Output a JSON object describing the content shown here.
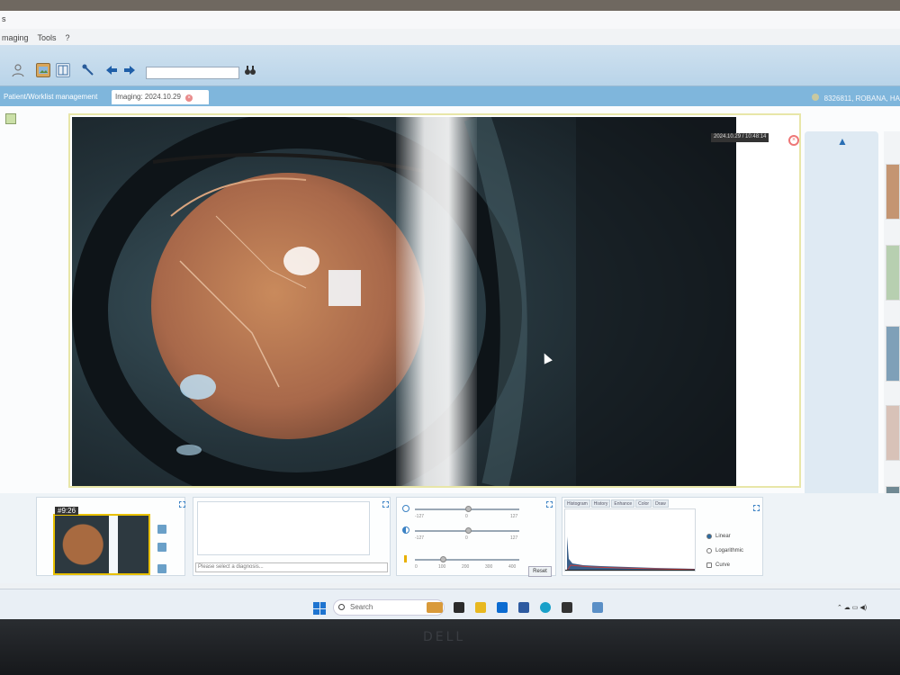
{
  "window": {
    "title_fragment": "s"
  },
  "menu": [
    "maging",
    "Tools",
    "?"
  ],
  "toolbar": {
    "buttons": [
      "users-icon",
      "picture-icon",
      "layout-icon",
      "tool-icon",
      "back-arrow-icon",
      "forward-arrow-icon",
      "binoculars-icon"
    ],
    "search_value": ""
  },
  "tabs": [
    {
      "label": "Patient/Worklist management",
      "active": true
    },
    {
      "label": "Imaging: 2024.10.29",
      "active": false,
      "closable": true
    }
  ],
  "patient_info": "8326811, ROBANA, HA",
  "viewer": {
    "timestamp": "2024.10.29 / 10:48:14"
  },
  "thumbnail": {
    "label": "#9:26"
  },
  "diagnosis": {
    "placeholder": "Please select a diagnosis..."
  },
  "adjust": {
    "slider1": {
      "min": "-127",
      "mid": "0",
      "max": "127"
    },
    "slider2": {
      "min": "-127",
      "mid": "0",
      "max": "127"
    },
    "slider3": {
      "ticks": [
        "0",
        "100",
        "200",
        "300",
        "400"
      ]
    },
    "reset_label": "Reset"
  },
  "histogram": {
    "tabs": [
      "Histogram",
      "History",
      "Enhance",
      "Color",
      "Draw"
    ],
    "options": [
      {
        "label": "Linear",
        "selected": true
      },
      {
        "label": "Logarithmic",
        "selected": false
      },
      {
        "label": "Curve",
        "selected": false
      }
    ]
  },
  "taskbar": {
    "search_label": "Search"
  },
  "monitor": {
    "brand": "DELL"
  }
}
